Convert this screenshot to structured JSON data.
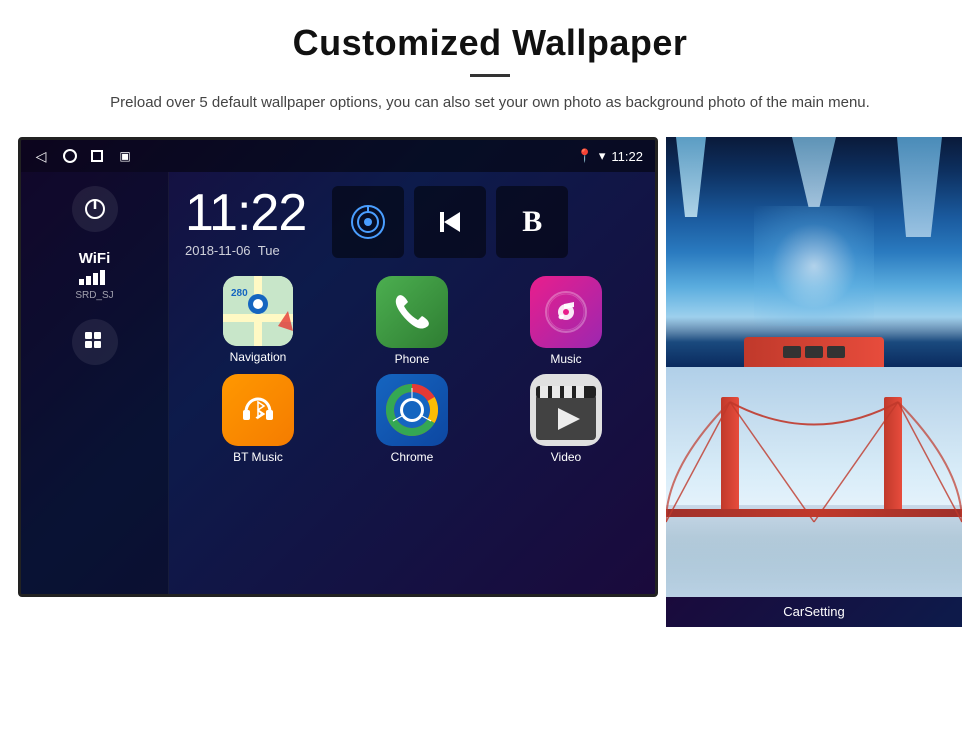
{
  "header": {
    "title": "Customized Wallpaper",
    "subtitle": "Preload over 5 default wallpaper options, you can also set your own photo as background photo of the main menu."
  },
  "statusBar": {
    "time": "11:22",
    "navIcons": [
      "◁",
      "○",
      "□",
      "▣"
    ]
  },
  "clock": {
    "time": "11:22",
    "date": "2018-11-06",
    "day": "Tue"
  },
  "wifi": {
    "label": "WiFi",
    "ssid": "SRD_SJ"
  },
  "apps": [
    {
      "name": "Navigation",
      "type": "navigation"
    },
    {
      "name": "Phone",
      "type": "phone"
    },
    {
      "name": "Music",
      "type": "music"
    },
    {
      "name": "BT Music",
      "type": "btmusic"
    },
    {
      "name": "Chrome",
      "type": "chrome"
    },
    {
      "name": "Video",
      "type": "video"
    }
  ],
  "wallpapers": [
    {
      "name": "ice-cave",
      "label": ""
    },
    {
      "name": "bridge",
      "label": "CarSetting"
    }
  ]
}
